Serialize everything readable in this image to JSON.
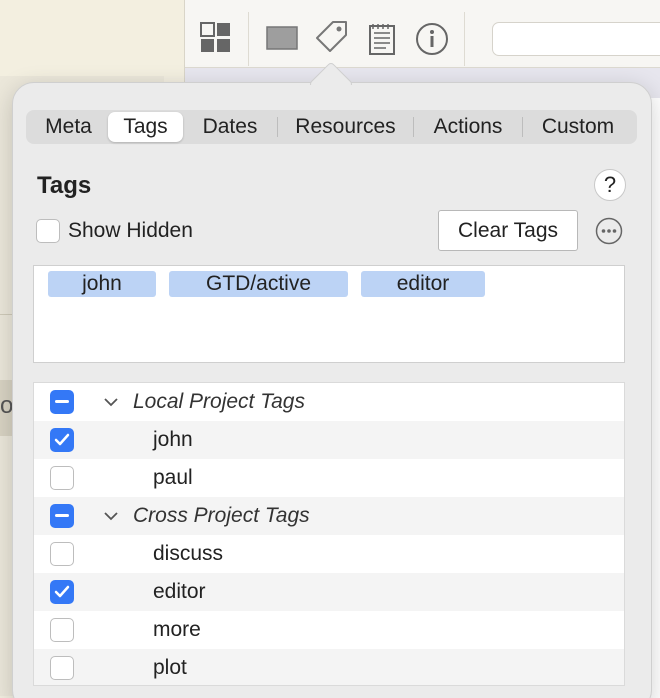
{
  "background": {
    "left_fragment_text": "o!"
  },
  "toolbar": {
    "icons": [
      "grid-view-icon",
      "rectangle-icon",
      "tag-icon",
      "notes-icon",
      "info-icon"
    ],
    "search_value": ""
  },
  "tabs": [
    {
      "label": "Meta",
      "active": false
    },
    {
      "label": "Tags",
      "active": true
    },
    {
      "label": "Dates",
      "active": false
    },
    {
      "label": "Resources",
      "active": false
    },
    {
      "label": "Actions",
      "active": false
    },
    {
      "label": "Custom",
      "active": false
    }
  ],
  "panel": {
    "title": "Tags",
    "help_label": "?",
    "show_hidden_label": "Show Hidden",
    "show_hidden_checked": false,
    "clear_button_label": "Clear Tags"
  },
  "applied_tags": [
    "john",
    "GTD/active",
    "editor"
  ],
  "tree": {
    "groups": [
      {
        "label": "Local Project Tags",
        "state": "mixed",
        "items": [
          {
            "label": "john",
            "checked": true
          },
          {
            "label": "paul",
            "checked": false
          }
        ]
      },
      {
        "label": "Cross Project Tags",
        "state": "mixed",
        "items": [
          {
            "label": "discuss",
            "checked": false
          },
          {
            "label": "editor",
            "checked": true
          },
          {
            "label": "more",
            "checked": false
          },
          {
            "label": "plot",
            "checked": false
          }
        ]
      }
    ]
  },
  "colors": {
    "accent": "#3478f6",
    "chip": "#bcd3f5",
    "popover_bg": "#ebebeb"
  }
}
